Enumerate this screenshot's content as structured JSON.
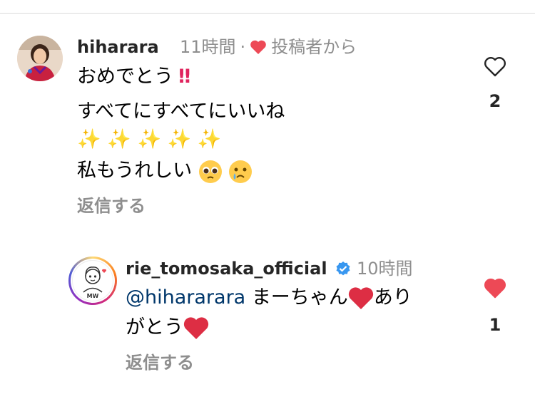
{
  "comment": {
    "username": "hiharara",
    "time": "11時間",
    "separator": "·",
    "creator_like_label": "投稿者から",
    "lines": [
      "おめでとう",
      "すべてにすべてにいいね",
      "私もうれしい"
    ],
    "reply_label": "返信する",
    "like_count": "2",
    "liked": false
  },
  "reply": {
    "username": "rie_tomosaka_official",
    "time": "10時間",
    "mention": "@hihararara",
    "text_after_mention": "まーちゃん",
    "text_line1_tail": "あり",
    "text_line2": "がとう",
    "reply_label": "返信する",
    "like_count": "1",
    "liked": true,
    "avatar_initials": "MW"
  },
  "colors": {
    "like_red": "#ed4956",
    "verified_blue": "#3897f0",
    "secondary_text": "#8e8e8e",
    "mention_blue": "#00376b"
  }
}
